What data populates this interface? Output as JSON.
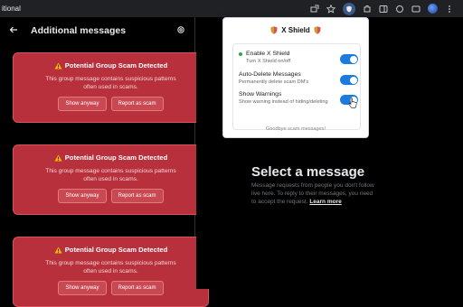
{
  "browser": {
    "url_fragment": "itional"
  },
  "left_panel": {
    "title": "Additional messages",
    "cards": [
      {
        "title": "Potential Group Scam Detected",
        "body": "This group message contains suspicious patterns often used in scams.",
        "show_label": "Show anyway",
        "report_label": "Report as scam"
      },
      {
        "title": "Potential Group Scam Detected",
        "body": "This group message contains suspicious patterns often used in scams.",
        "show_label": "Show anyway",
        "report_label": "Report as scam"
      },
      {
        "title": "Potential Group Scam Detected",
        "body": "This group message contains suspicious patterns often used in scams.",
        "show_label": "Show anyway",
        "report_label": "Report as scam"
      }
    ]
  },
  "main": {
    "title": "Select a message",
    "description": "Message requests from people you don't follow live here. To reply to their messages, you need to accept the request.",
    "learn_more": "Learn more"
  },
  "popup": {
    "title": "X Shield",
    "settings": [
      {
        "title": "Enable X Shield",
        "subtitle": "Turn X Shield on/off",
        "enabled": true
      },
      {
        "title": "Auto-Delete Messages",
        "subtitle": "Permanently delete scam DM's",
        "enabled": true
      },
      {
        "title": "Show Warnings",
        "subtitle": "Show warning instead of hiding/deleting",
        "enabled": true
      }
    ],
    "footer": "Goodbye scam messages!"
  },
  "colors": {
    "card_bg": "#b8303c",
    "toggle_on": "#1d7be0",
    "status_dot": "#2ea44f"
  }
}
